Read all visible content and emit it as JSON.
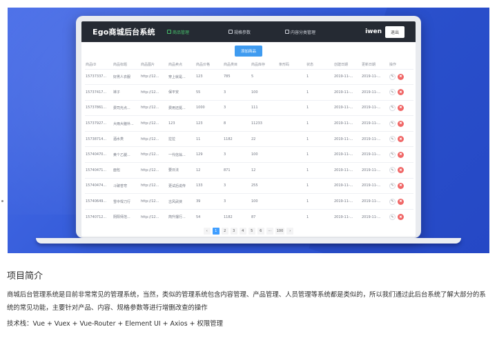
{
  "app": {
    "title": "Ego商城后台系统",
    "nav": [
      {
        "label": "商品管理",
        "active": true,
        "icon": "box-icon"
      },
      {
        "label": "规格参数",
        "active": false,
        "icon": "doc-icon"
      },
      {
        "label": "内容分类管理",
        "active": false,
        "icon": "folder-icon"
      }
    ],
    "user": "iwen",
    "logout_label": "退出"
  },
  "toolbar": {
    "add_label": "添加商品"
  },
  "table": {
    "columns": [
      "商品ID",
      "商品标题",
      "商品图片",
      "商品卖点",
      "商品价格",
      "商品类目",
      "商品库存",
      "条形码",
      "状态",
      "创建日期",
      "更新日期",
      "操作"
    ],
    "rows": [
      [
        "15737337...",
        "好男人衣服",
        "http://12...",
        "穿上就是...",
        "123",
        "785",
        "5",
        "",
        "1",
        "2019-11-...",
        "2019-11-..."
      ],
      [
        "15737417...",
        "袜子",
        "http://12...",
        "保平安",
        "55",
        "3",
        "100",
        "",
        "1",
        "2019-11-...",
        "2019-11-..."
      ],
      [
        "15737861...",
        "费司光点...",
        "http://12...",
        "费用还挺...",
        "1000",
        "3",
        "111",
        "",
        "1",
        "2019-11-...",
        "2019-11-..."
      ],
      [
        "15737927...",
        "大雨大脑补...",
        "http://12...",
        "123",
        "123",
        "8",
        "11233",
        "",
        "1",
        "2019-11-...",
        "2019-11-..."
      ],
      [
        "15738714...",
        "酒水类",
        "http://12...",
        "拉拉",
        "11",
        "1182",
        "22",
        "",
        "1",
        "2019-11-...",
        "2019-11-..."
      ],
      [
        "15740470...",
        "黄个乙腿...",
        "http://12...",
        "一代信翁...",
        "129",
        "3",
        "100",
        "",
        "1",
        "2019-11-...",
        "2019-11-..."
      ],
      [
        "15740471...",
        "面包",
        "http://12...",
        "要日法",
        "12",
        "871",
        "12",
        "",
        "1",
        "2019-11-...",
        "2019-11-..."
      ],
      [
        "15740474...",
        "斗破苍穹",
        "http://12...",
        "更试后说传",
        "133",
        "3",
        "255",
        "",
        "1",
        "2019-11-...",
        "2019-11-..."
      ],
      [
        "15740649...",
        "雪中悍刀行",
        "http://12...",
        "古风武侠",
        "39",
        "3",
        "100",
        "",
        "1",
        "2019-11-...",
        "2019-11-..."
      ],
      [
        "15740712...",
        "阴阳师范...",
        "http://12...",
        "简升摆行...",
        "54",
        "1182",
        "87",
        "",
        "1",
        "2019-11-...",
        "2019-11-..."
      ]
    ],
    "edit_glyph": "✎",
    "delete_glyph": "✖"
  },
  "pager": {
    "prev": "‹",
    "pages": [
      "1",
      "2",
      "3",
      "4",
      "5",
      "6",
      "···",
      "100"
    ],
    "active": "1",
    "next": "›"
  },
  "intro": {
    "title": "项目简介",
    "description": "商城后台管理系统是目前非常常见的管理系统，当然，类似的管理系统包含内容管理、产品管理、人员管理等系统都是类似的，所以我们通过此后台系统了解大部分的系统的常见功能，主要针对产品、内容、规格参数等进行增删改查的操作",
    "stack": "技术栈：Vue + Vuex + Vue-Router + Element UI + Axios + 权限管理"
  },
  "colors": {
    "hero": "#2f57d6",
    "header": "#252a33",
    "accent": "#409eff",
    "danger": "#f06767",
    "active_nav": "#46c06b"
  }
}
